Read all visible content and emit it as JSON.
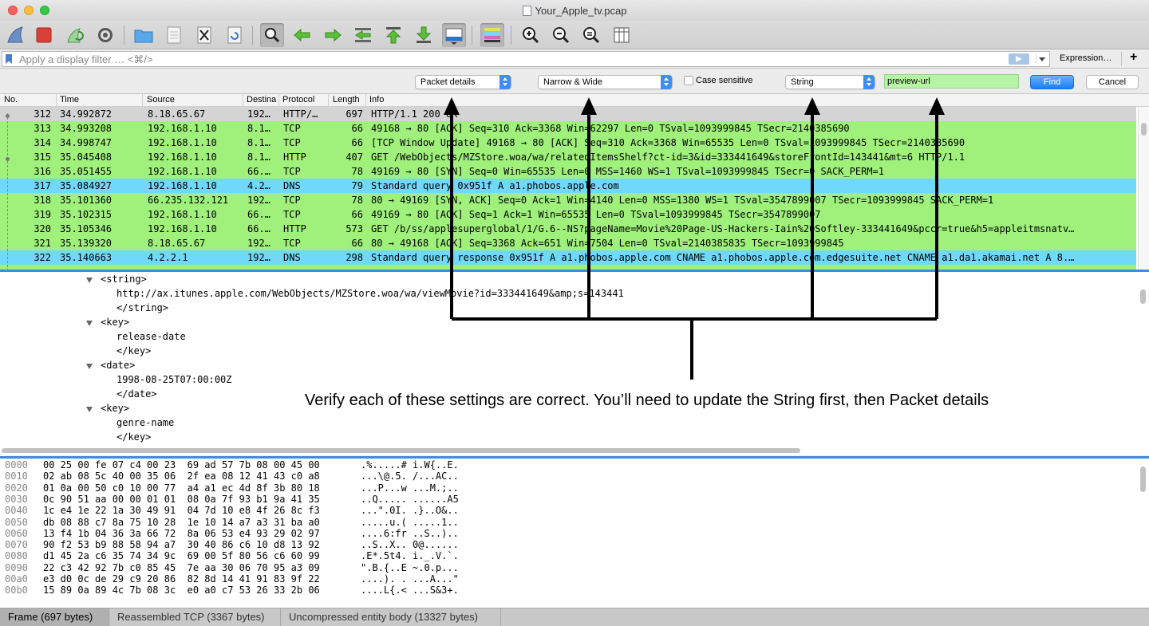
{
  "window": {
    "title": "Your_Apple_tv.pcap"
  },
  "filter": {
    "placeholder": "Apply a display filter … <⌘/>",
    "expression_label": "Expression…",
    "add_label": "+"
  },
  "find": {
    "search_in": "Packet details",
    "char_width": "Narrow & Wide",
    "case_sensitive_label": "Case sensitive",
    "search_type": "String",
    "search_value": "preview-url",
    "find_label": "Find",
    "cancel_label": "Cancel"
  },
  "packet_list": {
    "columns": [
      "No.",
      "Time",
      "Source",
      "Destina",
      "Protocol",
      "Length",
      "Info"
    ],
    "colors": {
      "selected": "#d4d4d4",
      "tcp": "#a0f07c",
      "dns": "#70d8f8",
      "http": "#a0f07c"
    },
    "rows": [
      {
        "no": "312",
        "time": "34.992872",
        "src": "8.18.65.67",
        "dst": "192…",
        "proto": "HTTP/…",
        "len": "697",
        "info": "HTTP/1.1 200 OK",
        "kind": "selected"
      },
      {
        "no": "313",
        "time": "34.993208",
        "src": "192.168.1.10",
        "dst": "8.1…",
        "proto": "TCP",
        "len": "66",
        "info": "49168 → 80 [ACK] Seq=310 Ack=3368 Win=62297 Len=0 TSval=1093999845 TSecr=2140385690",
        "kind": "tcp"
      },
      {
        "no": "314",
        "time": "34.998747",
        "src": "192.168.1.10",
        "dst": "8.1…",
        "proto": "TCP",
        "len": "66",
        "info": "[TCP Window Update] 49168 → 80 [ACK] Seq=310 Ack=3368 Win=65535 Len=0 TSval=1093999845 TSecr=2140385690",
        "kind": "tcp"
      },
      {
        "no": "315",
        "time": "35.045408",
        "src": "192.168.1.10",
        "dst": "8.1…",
        "proto": "HTTP",
        "len": "407",
        "info": "GET /WebObjects/MZStore.woa/wa/relatedItemsShelf?ct-id=3&id=333441649&storeFrontId=143441&mt=6 HTTP/1.1",
        "kind": "http"
      },
      {
        "no": "316",
        "time": "35.051455",
        "src": "192.168.1.10",
        "dst": "66.…",
        "proto": "TCP",
        "len": "78",
        "info": "49169 → 80 [SYN] Seq=0 Win=65535 Len=0 MSS=1460 WS=1 TSval=1093999845 TSecr=0 SACK_PERM=1",
        "kind": "tcp"
      },
      {
        "no": "317",
        "time": "35.084927",
        "src": "192.168.1.10",
        "dst": "4.2…",
        "proto": "DNS",
        "len": "79",
        "info": "Standard query 0x951f A a1.phobos.apple.com",
        "kind": "dns"
      },
      {
        "no": "318",
        "time": "35.101360",
        "src": "66.235.132.121",
        "dst": "192…",
        "proto": "TCP",
        "len": "78",
        "info": "80 → 49169 [SYN, ACK] Seq=0 Ack=1 Win=4140 Len=0 MSS=1380 WS=1 TSval=3547899007 TSecr=1093999845 SACK_PERM=1",
        "kind": "tcp"
      },
      {
        "no": "319",
        "time": "35.102315",
        "src": "192.168.1.10",
        "dst": "66.…",
        "proto": "TCP",
        "len": "66",
        "info": "49169 → 80 [ACK] Seq=1 Ack=1 Win=65535 Len=0 TSval=1093999845 TSecr=3547899007",
        "kind": "tcp"
      },
      {
        "no": "320",
        "time": "35.105346",
        "src": "192.168.1.10",
        "dst": "66.…",
        "proto": "HTTP",
        "len": "573",
        "info": "GET /b/ss/applesuperglobal/1/G.6--NS?pageName=Movie%20Page-US-Hackers-Iain%20Softley-333441649&pccr=true&h5=appleitmsnatv…",
        "kind": "http"
      },
      {
        "no": "321",
        "time": "35.139320",
        "src": "8.18.65.67",
        "dst": "192…",
        "proto": "TCP",
        "len": "66",
        "info": "80 → 49168 [ACK] Seq=3368 Ack=651 Win=7504 Len=0 TSval=2140385835 TSecr=1093999845",
        "kind": "tcp"
      },
      {
        "no": "322",
        "time": "35.140663",
        "src": "4.2.2.1",
        "dst": "192…",
        "proto": "DNS",
        "len": "298",
        "info": "Standard query response 0x951f A a1.phobos.apple.com CNAME a1.phobos.apple.com.edgesuite.net CNAME a1.da1.akamai.net A 8.…",
        "kind": "dns"
      }
    ]
  },
  "details": {
    "rows": [
      {
        "text": "<string>",
        "indent": 0,
        "expandable": true
      },
      {
        "text": "http://ax.itunes.apple.com/WebObjects/MZStore.woa/wa/viewMovie?id=333441649&amp;s=143441",
        "indent": 1,
        "expandable": false
      },
      {
        "text": "</string>",
        "indent": 1,
        "expandable": false
      },
      {
        "text": "<key>",
        "indent": 0,
        "expandable": true
      },
      {
        "text": "release-date",
        "indent": 1,
        "expandable": false
      },
      {
        "text": "</key>",
        "indent": 1,
        "expandable": false
      },
      {
        "text": "<date>",
        "indent": 0,
        "expandable": true
      },
      {
        "text": "1998-08-25T07:00:00Z",
        "indent": 1,
        "expandable": false
      },
      {
        "text": "</date>",
        "indent": 1,
        "expandable": false
      },
      {
        "text": "<key>",
        "indent": 0,
        "expandable": true
      },
      {
        "text": "genre-name",
        "indent": 1,
        "expandable": false
      },
      {
        "text": "</key>",
        "indent": 1,
        "expandable": false
      }
    ]
  },
  "bytes": {
    "rows": [
      {
        "offset": "0000",
        "hex": "00 25 00 fe 07 c4 00 23  69 ad 57 7b 08 00 45 00",
        "ascii": ".%.....# i.W{..E."
      },
      {
        "offset": "0010",
        "hex": "02 ab 08 5c 40 00 35 06  2f ea 08 12 41 43 c0 a8",
        "ascii": "...\\@.5. /...AC.."
      },
      {
        "offset": "0020",
        "hex": "01 0a 00 50 c0 10 00 77  a4 a1 ec 4d 8f 3b 80 18",
        "ascii": "...P...w ...M.;.."
      },
      {
        "offset": "0030",
        "hex": "0c 90 51 aa 00 00 01 01  08 0a 7f 93 b1 9a 41 35",
        "ascii": "..Q..... ......A5"
      },
      {
        "offset": "0040",
        "hex": "1c e4 1e 22 1a 30 49 91  04 7d 10 e8 4f 26 8c f3",
        "ascii": "...\".0I. .}..O&.."
      },
      {
        "offset": "0050",
        "hex": "db 08 88 c7 8a 75 10 28  1e 10 14 a7 a3 31 ba a0",
        "ascii": ".....u.( .....1.."
      },
      {
        "offset": "0060",
        "hex": "13 f4 1b 04 36 3a 66 72  8a 06 53 e4 93 29 02 97",
        "ascii": "....6:fr ..S..).."
      },
      {
        "offset": "0070",
        "hex": "90 f2 53 b9 88 58 94 a7  30 40 86 c6 10 d8 13 92",
        "ascii": "..S..X.. 0@......"
      },
      {
        "offset": "0080",
        "hex": "d1 45 2a c6 35 74 34 9c  69 00 5f 80 56 c6 60 99",
        "ascii": ".E*.5t4. i._.V.`."
      },
      {
        "offset": "0090",
        "hex": "22 c3 42 92 7b c0 85 45  7e aa 30 06 70 95 a3 09",
        "ascii": "\".B.{..E ~.0.p..."
      },
      {
        "offset": "00a0",
        "hex": "e3 d0 0c de 29 c9 20 86  82 8d 14 41 91 83 9f 22",
        "ascii": "....). . ...A...\""
      },
      {
        "offset": "00b0",
        "hex": "15 89 0a 89 4c 7b 08 3c  e0 a0 c7 53 26 33 2b 06",
        "ascii": "....L{.< ...S&3+."
      }
    ]
  },
  "status": {
    "tabs": [
      "Frame (697 bytes)",
      "Reassembled TCP (3367 bytes)",
      "Uncompressed entity body (13327 bytes)"
    ]
  },
  "annotation": {
    "text": "Verify each of these settings are correct. You’ll need to update the String first, then Packet details"
  },
  "toolbar": {
    "icons": [
      "shark-fin-start-icon",
      "stop-capture-icon",
      "restart-capture-icon",
      "capture-options-gear-icon",
      "open-folder-icon",
      "file-icon",
      "close-file-icon",
      "reload-icon",
      "find-magnifier-icon",
      "back-arrow-icon",
      "forward-arrow-icon",
      "go-to-packet-icon",
      "first-packet-icon",
      "last-packet-icon",
      "autoscroll-icon",
      "colorize-icon",
      "zoom-in-icon",
      "zoom-out-icon",
      "zoom-normal-icon",
      "resize-columns-icon"
    ]
  }
}
